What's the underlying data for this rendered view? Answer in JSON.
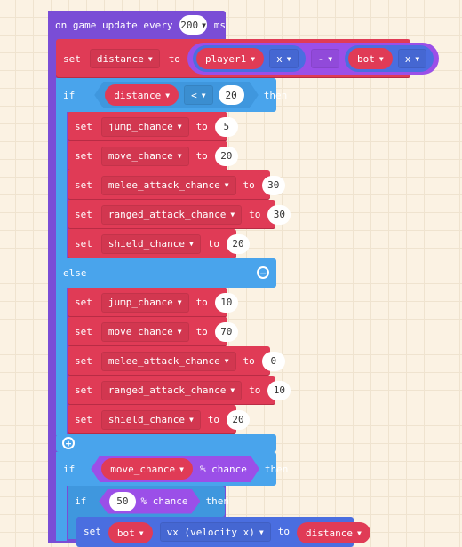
{
  "event": {
    "label_prefix": "on game update every",
    "interval": "200",
    "label_suffix": "ms"
  },
  "distance_set": {
    "set": "set",
    "variable": "distance",
    "to": "to",
    "left_sprite": "player1",
    "left_prop": "x",
    "operator": "-",
    "right_sprite": "bot",
    "right_prop": "x"
  },
  "if1": {
    "if": "if",
    "variable": "distance",
    "comparator": "<",
    "value": "20",
    "then": "then",
    "else": "else"
  },
  "then_sets": [
    {
      "set": "set",
      "variable": "jump_chance",
      "to": "to",
      "value": "5"
    },
    {
      "set": "set",
      "variable": "move_chance",
      "to": "to",
      "value": "20"
    },
    {
      "set": "set",
      "variable": "melee_attack_chance",
      "to": "to",
      "value": "30"
    },
    {
      "set": "set",
      "variable": "ranged_attack_chance",
      "to": "to",
      "value": "30"
    },
    {
      "set": "set",
      "variable": "shield_chance",
      "to": "to",
      "value": "20"
    }
  ],
  "else_sets": [
    {
      "set": "set",
      "variable": "jump_chance",
      "to": "to",
      "value": "10"
    },
    {
      "set": "set",
      "variable": "move_chance",
      "to": "to",
      "value": "70"
    },
    {
      "set": "set",
      "variable": "melee_attack_chance",
      "to": "to",
      "value": "0"
    },
    {
      "set": "set",
      "variable": "ranged_attack_chance",
      "to": "to",
      "value": "10"
    },
    {
      "set": "set",
      "variable": "shield_chance",
      "to": "to",
      "value": "20"
    }
  ],
  "if2": {
    "if": "if",
    "variable": "move_chance",
    "chance_label": "% chance",
    "then": "then"
  },
  "if3": {
    "if": "if",
    "value": "50",
    "chance_label": "% chance",
    "then": "then"
  },
  "velocity_set": {
    "set": "set",
    "sprite": "bot",
    "property": "vx (velocity x)",
    "to": "to",
    "value_variable": "distance"
  },
  "icons": {
    "dropdown": "▼",
    "remove_else": "−",
    "add_else": "+"
  },
  "colors": {
    "event_purple": "#7a4dd6",
    "variable_red": "#e03b56",
    "logic_blue": "#49a4ec",
    "sprite_blue": "#4a6ee0",
    "math_purple": "#9b4fe8",
    "canvas_bg": "#fbf2e3"
  }
}
